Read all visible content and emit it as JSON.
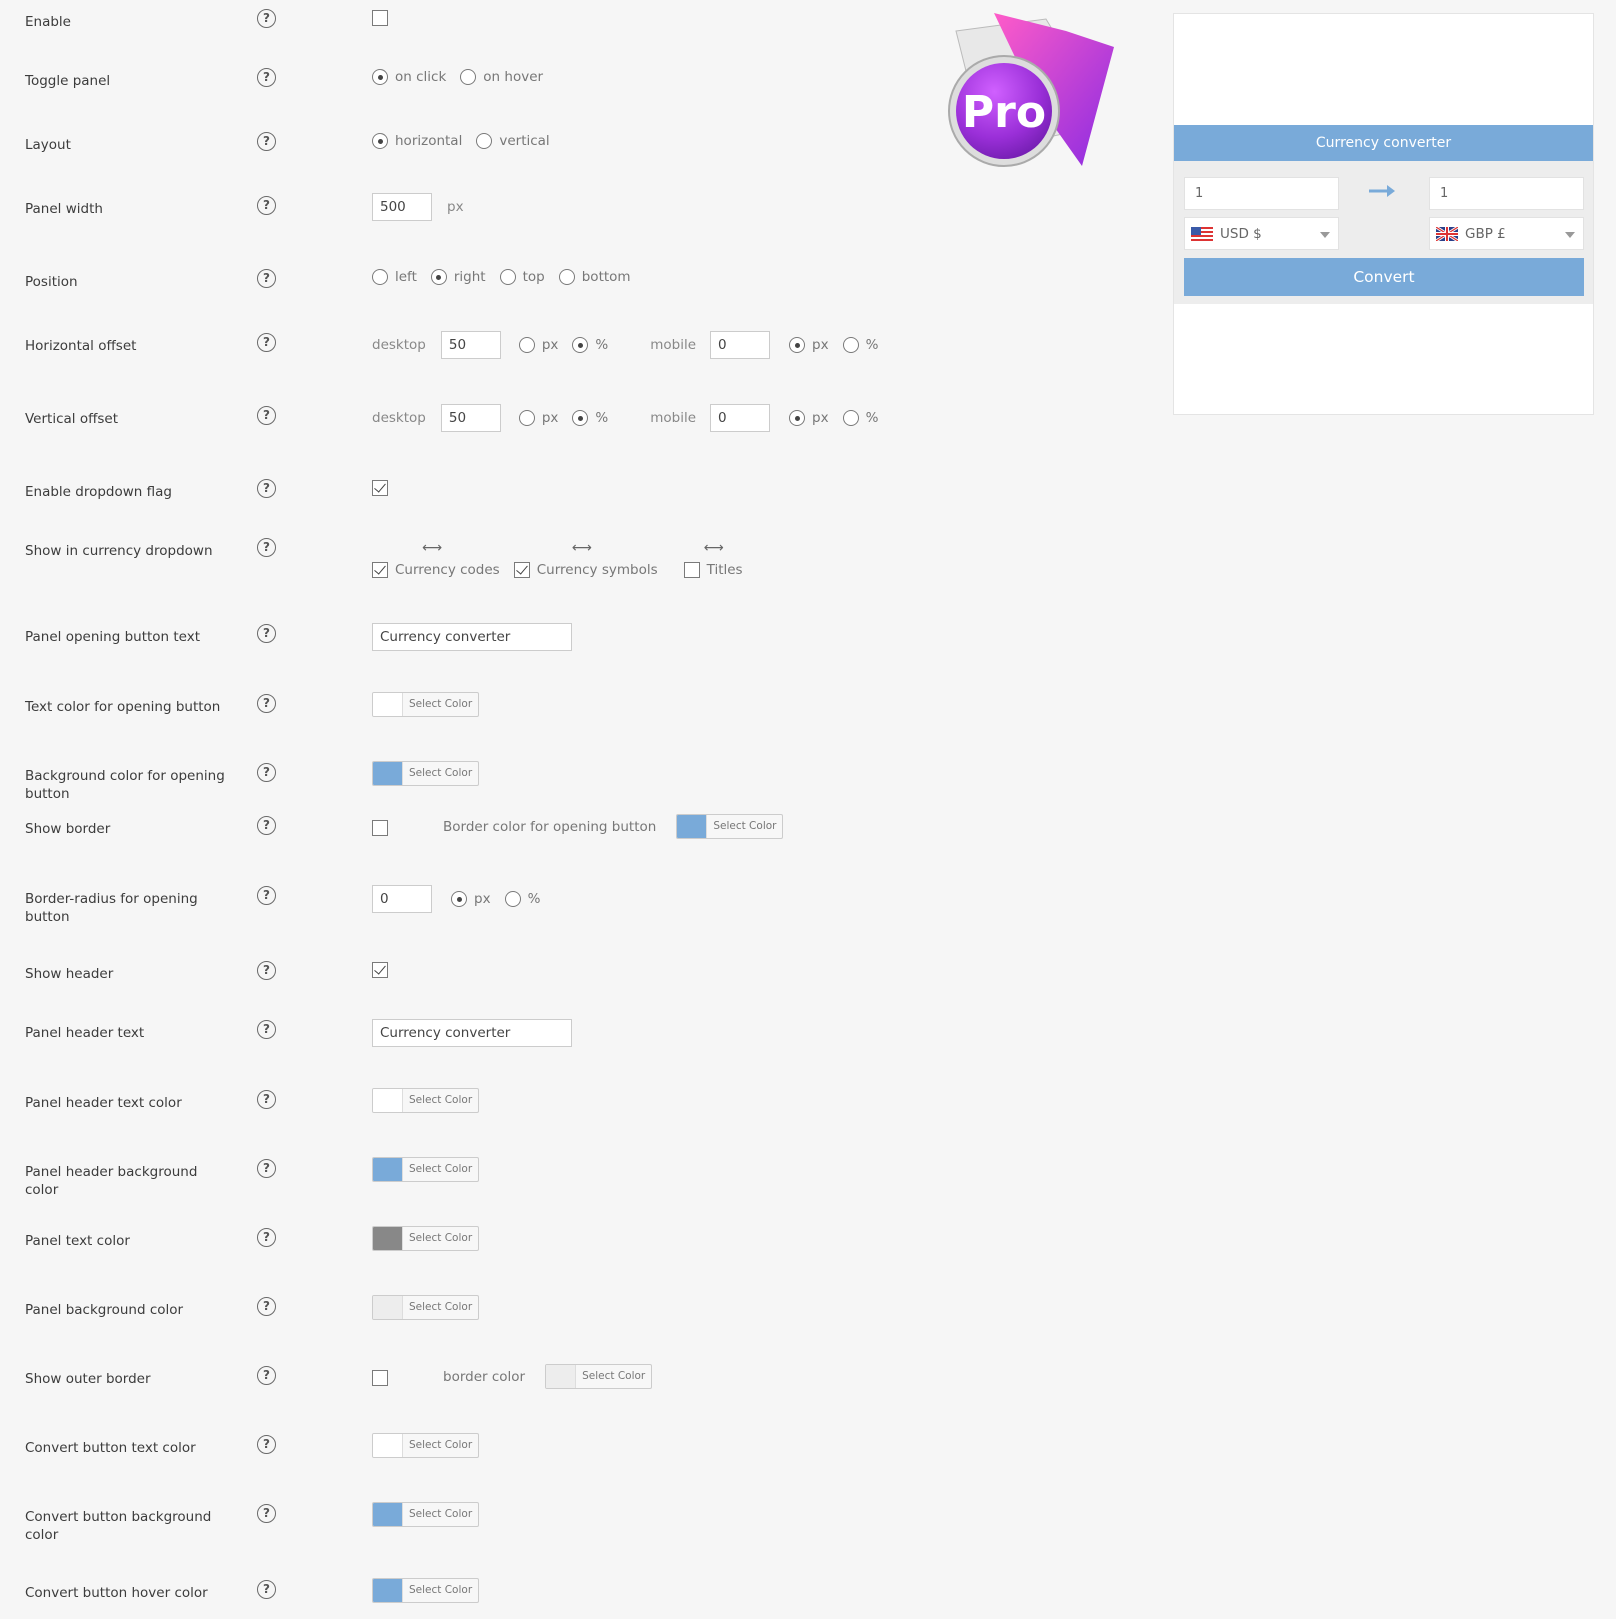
{
  "colors": {
    "blue": "#79aad9",
    "white": "#ffffff",
    "gray": "#888888",
    "light": "#ededed"
  },
  "help_glyph": "?",
  "select_color": "Select Color",
  "rows": {
    "enable": {
      "label": "Enable",
      "checked": false
    },
    "toggle_panel": {
      "label": "Toggle panel",
      "options": [
        "on click",
        "on hover"
      ],
      "selected": "on click"
    },
    "layout": {
      "label": "Layout",
      "options": [
        "horizontal",
        "vertical"
      ],
      "selected": "horizontal"
    },
    "panel_width": {
      "label": "Panel width",
      "value": "500",
      "unit": "px"
    },
    "position": {
      "label": "Position",
      "options": [
        "left",
        "right",
        "top",
        "bottom"
      ],
      "selected": "right"
    },
    "h_offset": {
      "label": "Horizontal offset",
      "desktop_label": "desktop",
      "desktop_value": "50",
      "mobile_label": "mobile",
      "mobile_value": "0",
      "units": [
        "px",
        "%"
      ],
      "desktop_unit": "%",
      "mobile_unit": "px"
    },
    "v_offset": {
      "label": "Vertical offset",
      "desktop_label": "desktop",
      "desktop_value": "50",
      "mobile_label": "mobile",
      "mobile_value": "0",
      "units": [
        "px",
        "%"
      ],
      "desktop_unit": "%",
      "mobile_unit": "px"
    },
    "dropdown_flag": {
      "label": "Enable dropdown flag",
      "checked": true
    },
    "show_in_dropdown": {
      "label": "Show in currency dropdown",
      "items": [
        {
          "label": "Currency codes",
          "checked": true
        },
        {
          "label": "Currency symbols",
          "checked": true
        },
        {
          "label": "Titles",
          "checked": false
        }
      ]
    },
    "open_btn_text": {
      "label": "Panel opening button text",
      "value": "Currency converter"
    },
    "open_btn_text_color": {
      "label": "Text color for opening button",
      "color": "#ffffff"
    },
    "open_btn_bg_color": {
      "label": "Background color for opening button",
      "color": "#79aad9"
    },
    "show_border": {
      "label": "Show border",
      "checked": false,
      "border_color_label": "Border color for opening button",
      "color": "#79aad9"
    },
    "border_radius": {
      "label": "Border-radius for opening button",
      "value": "0",
      "units": [
        "px",
        "%"
      ],
      "selected": "px"
    },
    "show_header": {
      "label": "Show header",
      "checked": true
    },
    "header_text": {
      "label": "Panel header text",
      "value": "Currency converter"
    },
    "header_text_color": {
      "label": "Panel header text color",
      "color": "#ffffff"
    },
    "header_bg_color": {
      "label": "Panel header background color",
      "color": "#79aad9"
    },
    "panel_text_color": {
      "label": "Panel text color",
      "color": "#888888"
    },
    "panel_bg_color": {
      "label": "Panel background color",
      "color": "#ededed"
    },
    "outer_border": {
      "label": "Show outer border",
      "checked": false,
      "border_color_label": "border color",
      "color": "#ededed"
    },
    "convert_text_color": {
      "label": "Convert button text color",
      "color": "#ffffff"
    },
    "convert_bg_color": {
      "label": "Convert button background color",
      "color": "#79aad9"
    },
    "convert_hover_color": {
      "label": "Convert button hover color",
      "color": "#79aad9"
    }
  },
  "logo": {
    "text": "Pro"
  },
  "preview": {
    "header": "Currency converter",
    "from_amount": "1",
    "to_amount": "1",
    "from_currency": "USD $",
    "to_currency": "GBP £",
    "convert": "Convert"
  }
}
